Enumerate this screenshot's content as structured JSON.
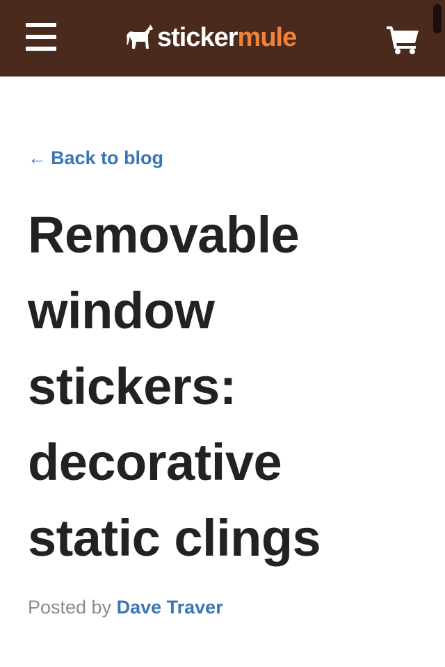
{
  "header": {
    "menu_icon": "hamburger-menu-icon",
    "logo": {
      "part1": "sticker",
      "part2": "mule",
      "icon": "mule-icon"
    },
    "cart_icon": "shopping-cart-icon"
  },
  "colors": {
    "header_bg": "#4a2a1d",
    "logo_accent": "#f1823b",
    "link": "#3a75b5",
    "text": "#222222",
    "muted": "#8a8a8a"
  },
  "article": {
    "back_link": "Back to blog",
    "back_arrow": "←",
    "title_lines": [
      "Removable",
      "window",
      "stickers:",
      "decorative",
      "static clings"
    ],
    "posted_by_label": "Posted by",
    "author": "Dave Traver"
  }
}
